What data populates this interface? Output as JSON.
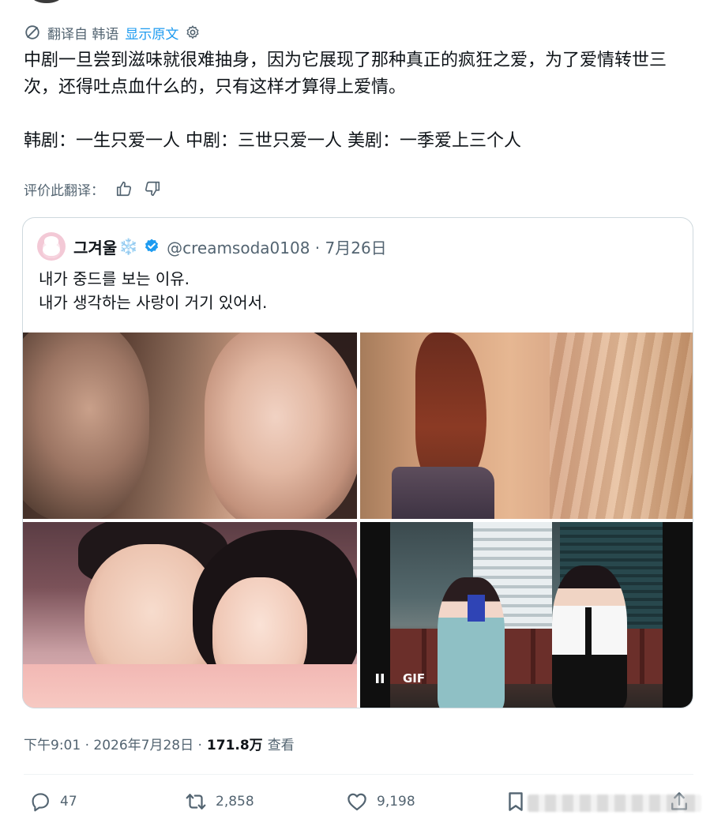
{
  "translation": {
    "prefix": "翻译自 韩语",
    "show_original": "显示原文"
  },
  "tweet": {
    "paragraph1": "中剧一旦尝到滋味就很难抽身，因为它展现了那种真正的疯狂之爱，为了爱情转世三次，还得吐点血什么的，只有这样才算得上爱情。",
    "paragraph2": "韩剧：一生只爱一人 中剧：三世只爱一人 美剧：一季爱上三个人"
  },
  "rate": {
    "label": "评价此翻译："
  },
  "quote": {
    "name": "그겨울",
    "name_emoji": "❄️",
    "handle_date": "@creamsoda0108 · 7月26日",
    "line1": "내가 중드를 보는 이유.",
    "line2": "내가 생각하는 사랑이 거기 있어서.",
    "gif_label": "GIF"
  },
  "meta": {
    "time_date": "下午9:01 · 2026年7月28日 ·",
    "views_count": "171.8万",
    "views_label": "查看"
  },
  "actions": {
    "replies": "47",
    "retweets": "2,858",
    "likes": "9,198"
  },
  "colors": {
    "accent": "#1d9bf0",
    "secondary_text": "#536471",
    "primary_text": "#0f1419",
    "border": "#cfd9de"
  },
  "icons": [
    "translate-icon",
    "gear-icon",
    "thumbs-up-icon",
    "thumbs-down-icon",
    "verified-badge-icon",
    "pause-icon",
    "reply-icon",
    "retweet-icon",
    "like-icon",
    "bookmark-icon",
    "share-icon"
  ]
}
